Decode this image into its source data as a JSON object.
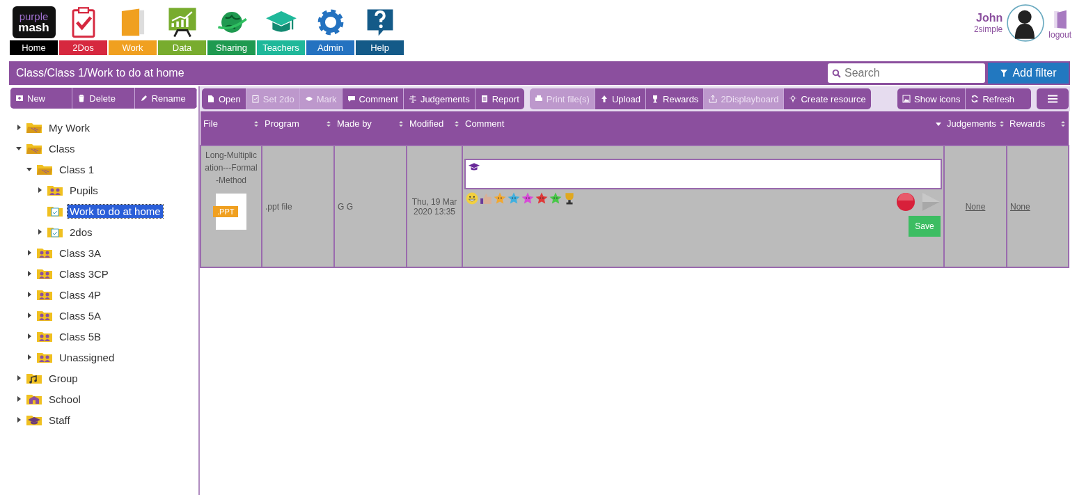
{
  "logo": {
    "line_1": "purple",
    "line_2": "mash"
  },
  "nav": [
    {
      "label": "Home",
      "color": "#000000",
      "kind": "logo"
    },
    {
      "label": "2Dos",
      "color": "#d6283f",
      "kind": "clipboard"
    },
    {
      "label": "Work",
      "color": "#f0a020",
      "kind": "notebook"
    },
    {
      "label": "Data",
      "color": "#78ac2e",
      "kind": "chart"
    },
    {
      "label": "Sharing",
      "color": "#1f9a50",
      "kind": "globe"
    },
    {
      "label": "Teachers",
      "color": "#1fb89a",
      "kind": "cap"
    },
    {
      "label": "Admin",
      "color": "#2472c0",
      "kind": "gear"
    },
    {
      "label": "Help",
      "color": "#145a88",
      "kind": "help"
    }
  ],
  "user": {
    "name": "John",
    "organisation": "2simple",
    "logout": "logout"
  },
  "path_bar": {
    "path": "Class/Class 1/Work to do at home",
    "search": {
      "placeholder": "Search"
    },
    "add_filter": "Add filter"
  },
  "tree_toolbar": [
    {
      "label": "New",
      "kind": "new"
    },
    {
      "label": "Delete",
      "kind": "trash"
    },
    {
      "label": "Rename",
      "kind": "pencil"
    }
  ],
  "toolbar_groups": [
    [
      {
        "label": "Open",
        "kind": "page",
        "disabled": false
      },
      {
        "label": "Set 2do",
        "kind": "check",
        "disabled": true
      },
      {
        "label": "Mark",
        "kind": "eye",
        "disabled": true
      },
      {
        "label": "Comment",
        "kind": "speech",
        "disabled": false
      },
      {
        "label": "Judgements",
        "kind": "scale",
        "disabled": false
      },
      {
        "label": "Report",
        "kind": "report",
        "disabled": false
      }
    ],
    [
      {
        "label": "Print file(s)",
        "kind": "printer",
        "disabled": true
      },
      {
        "label": "Upload",
        "kind": "up",
        "disabled": false
      },
      {
        "label": "Rewards",
        "kind": "trophy",
        "disabled": false
      },
      {
        "label": "2Displayboard",
        "kind": "share",
        "disabled": true
      },
      {
        "label": "Create resource",
        "kind": "bulb",
        "disabled": false
      }
    ],
    [
      {
        "label": "Show icons",
        "kind": "image",
        "disabled": false
      },
      {
        "label": "Refresh",
        "kind": "refresh",
        "disabled": false
      }
    ]
  ],
  "tree": [
    {
      "label": "My Work",
      "kind": "folder",
      "expanded": false,
      "selected": false
    },
    {
      "label": "Class",
      "kind": "folder",
      "expanded": true,
      "selected": false,
      "children": [
        {
          "label": "Class 1",
          "kind": "folder",
          "expanded": true,
          "selected": false,
          "children": [
            {
              "label": "Pupils",
              "kind": "people",
              "expanded": false,
              "selected": false
            },
            {
              "label": "Work to do at home",
              "kind": "todo",
              "selected": true
            },
            {
              "label": "2dos",
              "kind": "todo",
              "expanded": false,
              "selected": false
            }
          ]
        },
        {
          "label": "Class 3A",
          "kind": "people",
          "expanded": false,
          "selected": false
        },
        {
          "label": "Class 3CP",
          "kind": "people",
          "expanded": false,
          "selected": false
        },
        {
          "label": "Class 4P",
          "kind": "people",
          "expanded": false,
          "selected": false
        },
        {
          "label": "Class 5A",
          "kind": "people",
          "expanded": false,
          "selected": false
        },
        {
          "label": "Class 5B",
          "kind": "people",
          "expanded": false,
          "selected": false
        },
        {
          "label": "Unassigned",
          "kind": "people",
          "expanded": false,
          "selected": false
        }
      ]
    },
    {
      "label": "Group",
      "kind": "group",
      "expanded": false,
      "selected": false
    },
    {
      "label": "School",
      "kind": "school",
      "expanded": false,
      "selected": false
    },
    {
      "label": "Staff",
      "kind": "staff",
      "expanded": false,
      "selected": false
    }
  ],
  "table": {
    "columns": [
      {
        "label": "File",
        "sorted": false
      },
      {
        "label": "Program",
        "sorted": false
      },
      {
        "label": "Made by",
        "sorted": false
      },
      {
        "label": "Modified",
        "sorted": false
      },
      {
        "label": "Comment",
        "sorted": true
      },
      {
        "label": "Judgements",
        "sorted": false
      },
      {
        "label": "Rewards",
        "sorted": false
      }
    ],
    "rows": [
      {
        "file": "Long-Multiplication---Formal-Method",
        "file_type": ".PPT",
        "program": ".ppt file",
        "made_by": "G G",
        "modified": "Thu, 19 Mar 2020 13:35",
        "reactions": [
          {
            "kind": "smiley"
          },
          {
            "kind": "thumb"
          },
          {
            "kind": "star",
            "color": "#f2a830"
          },
          {
            "kind": "star",
            "color": "#3fb0e0"
          },
          {
            "kind": "star",
            "color": "#d84ad8"
          },
          {
            "kind": "star",
            "color": "#e03838"
          },
          {
            "kind": "star",
            "color": "#48c848"
          },
          {
            "kind": "trophy"
          }
        ],
        "save": "Save",
        "judgements": "None",
        "rewards": "None"
      }
    ]
  }
}
